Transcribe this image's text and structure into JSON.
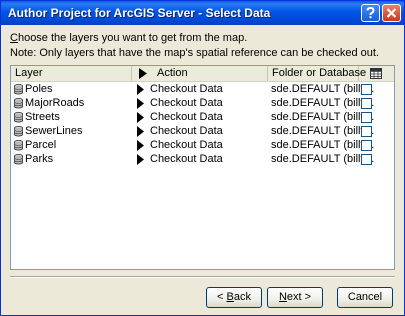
{
  "window": {
    "title": "Author Project for ArcGIS Server - Select Data"
  },
  "instructions": {
    "line1_prefix": "C",
    "line1_rest": "hoose the layers you want to get from the map.",
    "line2": "Note: Only layers that have the map's spatial reference can be checked out."
  },
  "table": {
    "headers": {
      "layer": "Layer",
      "action": "Action",
      "folder": "Folder or Database"
    },
    "rows": [
      {
        "layer": "Poles",
        "action": "Checkout Data",
        "folder": "sde.DEFAULT (billy...",
        "checked": false
      },
      {
        "layer": "MajorRoads",
        "action": "Checkout Data",
        "folder": "sde.DEFAULT (billy...",
        "checked": false
      },
      {
        "layer": "Streets",
        "action": "Checkout Data",
        "folder": "sde.DEFAULT (billy...",
        "checked": false
      },
      {
        "layer": "SewerLines",
        "action": "Checkout Data",
        "folder": "sde.DEFAULT (billy...",
        "checked": false
      },
      {
        "layer": "Parcel",
        "action": "Checkout Data",
        "folder": "sde.DEFAULT (billy...",
        "checked": false
      },
      {
        "layer": "Parks",
        "action": "Checkout Data",
        "folder": "sde.DEFAULT (billy...",
        "checked": false
      }
    ]
  },
  "buttons": {
    "back_prefix": "< ",
    "back_key": "B",
    "back_rest": "ack",
    "next_key": "N",
    "next_rest": "ext >",
    "cancel": "Cancel"
  },
  "icons": {
    "layer": "database-icon",
    "action": "triangle-right-icon",
    "select_all": "grid-icon"
  }
}
